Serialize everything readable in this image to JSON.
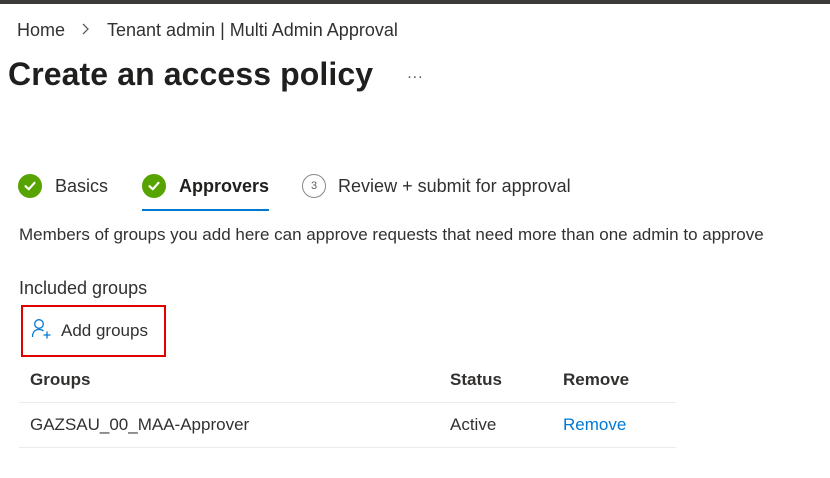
{
  "breadcrumb": {
    "home": "Home",
    "separator": ">",
    "current": "Tenant admin | Multi Admin Approval"
  },
  "page": {
    "title": "Create an access policy",
    "more_label": "..."
  },
  "steps": [
    {
      "label": "Basics",
      "state": "completed",
      "icon": "checkmark-icon"
    },
    {
      "label": "Approvers",
      "state": "active",
      "icon": "checkmark-icon"
    },
    {
      "label": "Review + submit for approval",
      "state": "pending",
      "number": "3"
    }
  ],
  "description": "Members of groups you add here can approve requests that need more than one admin to approve",
  "included_groups": {
    "heading": "Included groups",
    "add_button_label": "Add groups",
    "add_button_icon": "add-person-icon"
  },
  "grid": {
    "columns": [
      "Groups",
      "Status",
      "Remove"
    ],
    "rows": [
      {
        "group": "GAZSAU_00_MAA-Approver",
        "status": "Active",
        "action": "Remove"
      }
    ]
  },
  "colors": {
    "accent": "#0078d4",
    "success": "#57a300",
    "highlight_border": "#e00000"
  }
}
